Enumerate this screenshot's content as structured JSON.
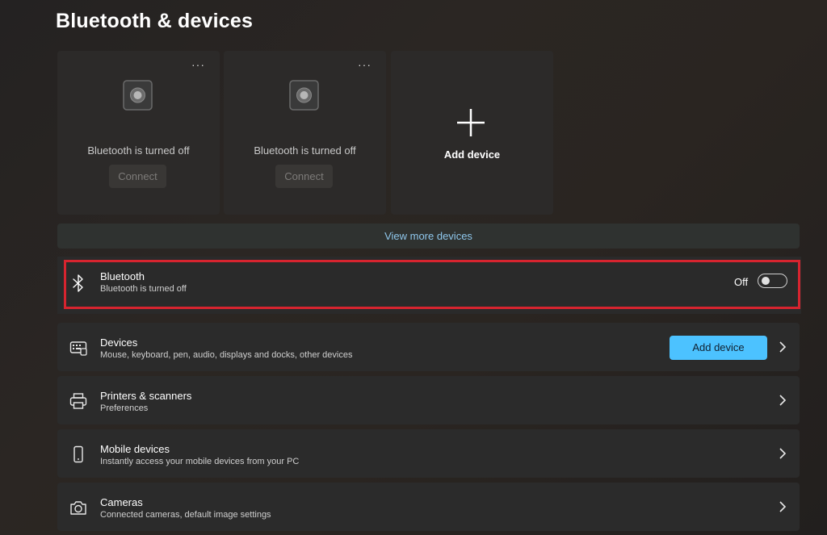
{
  "page": {
    "title": "Bluetooth & devices"
  },
  "device_cards": [
    {
      "status": "Bluetooth is turned off",
      "button": "Connect",
      "icon": "speaker-icon"
    },
    {
      "status": "Bluetooth is turned off",
      "button": "Connect",
      "icon": "speaker-icon"
    }
  ],
  "add_card": {
    "label": "Add device",
    "icon": "plus-icon"
  },
  "more_options": "···",
  "view_more": "View more devices",
  "bluetooth": {
    "title": "Bluetooth",
    "subtitle": "Bluetooth is turned off",
    "toggle_label": "Off",
    "toggle_on": false
  },
  "rows": [
    {
      "title": "Devices",
      "subtitle": "Mouse, keyboard, pen, audio, displays and docks, other devices",
      "button": "Add device",
      "icon": "keyboard-icon"
    },
    {
      "title": "Printers & scanners",
      "subtitle": "Preferences",
      "icon": "printer-icon"
    },
    {
      "title": "Mobile devices",
      "subtitle": "Instantly access your mobile devices from your PC",
      "icon": "phone-icon"
    },
    {
      "title": "Cameras",
      "subtitle": "Connected cameras, default image settings",
      "icon": "camera-icon"
    }
  ],
  "colors": {
    "accent": "#4cc2ff",
    "highlight": "#d7242f",
    "link": "#8fc7ec"
  }
}
